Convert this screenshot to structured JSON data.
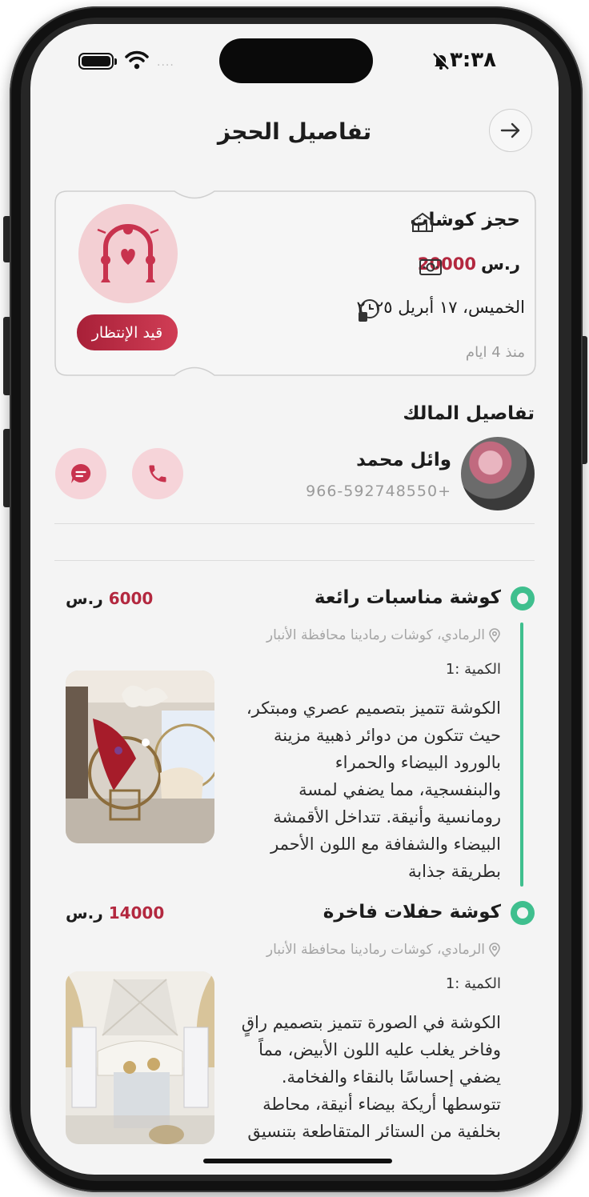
{
  "status_bar": {
    "time": "٣:٣٨",
    "signal": "....",
    "icons": [
      "battery-icon",
      "wifi-icon",
      "bell-muted-icon"
    ]
  },
  "header": {
    "title": "تفاصيل الحجز",
    "back_icon": "arrow-right-icon"
  },
  "booking": {
    "title": "حجز كوشات",
    "price_value": "20000",
    "price_currency": "ر.س",
    "date": "الخميس، ١٧ أبريل ٢٠٢٥",
    "ago": "منذ 4 ايام",
    "status": "قيد الإنتظار",
    "colors": {
      "accent": "#b3283f",
      "badge_from": "#a82038",
      "badge_to": "#d03d55",
      "avatar_bg": "#f3cfd3"
    }
  },
  "owner": {
    "heading": "تفاصيل المالك",
    "name": "وائل محمد",
    "phone": "966-592748550+"
  },
  "items": [
    {
      "title": "كوشة مناسبات رائعة",
      "price_value": "6000",
      "price_currency": "ر.س",
      "location": "الرمادي، كوشات رمادينا محافظة الأنبار",
      "quantity": "الكمية :1",
      "description_lines": [
        "الكوشة تتميز بتصميم عصري ومبتكر،",
        "حيث تتكون من دوائر ذهبية مزينة",
        "بالورود البيضاء والحمراء",
        "والبنفسجية، مما يضفي لمسة",
        "رومانسية وأنيقة. تتداخل الأقمشة",
        "البيضاء والشفافة مع اللون الأحمر",
        "بطريقة جذابة"
      ]
    },
    {
      "title": "كوشة حفلات فاخرة",
      "price_value": "14000",
      "price_currency": "ر.س",
      "location": "الرمادي، كوشات رمادينا محافظة الأنبار",
      "quantity": "الكمية :1",
      "description_lines": [
        "الكوشة في الصورة تتميز بتصميم راقٍ",
        "وفاخر يغلب عليه اللون الأبيض، مماً",
        "يضفي إحساسًا بالنقاء والفخامة.",
        "تتوسطها أريكة بيضاء أنيقة، محاطة",
        "بخلفية من الستائر المتقاطعة بتنسيق"
      ]
    }
  ],
  "theme": {
    "timeline": "#3fbf8e",
    "screen_bg": "#f4f4f4"
  }
}
